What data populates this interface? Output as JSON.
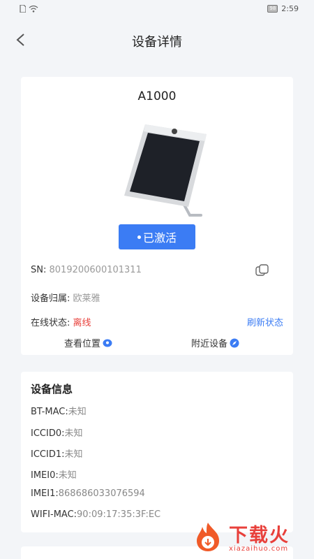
{
  "status_bar": {
    "time": "2:59",
    "battery": "98",
    "sim_icon": "sim-card-icon",
    "wifi_icon": "wifi-icon"
  },
  "nav": {
    "title": "设备详情",
    "back_icon": "chevron-left-icon"
  },
  "device": {
    "model": "A1000",
    "status_button": "已激活",
    "sn_label": "SN: ",
    "sn_value": "8019200600101311",
    "owner_label": "设备归属: ",
    "owner_value": "欧莱雅",
    "online_label": "在线状态: ",
    "online_value": "离线",
    "refresh_label": "刷新状态",
    "view_location": "查看位置",
    "nearby_devices": "附近设备"
  },
  "info": {
    "title": "设备信息",
    "rows": [
      {
        "label": "BT-MAC:",
        "value": "未知"
      },
      {
        "label": "ICCID0:",
        "value": "未知"
      },
      {
        "label": "ICCID1:",
        "value": "未知"
      },
      {
        "label": "IMEI0:",
        "value": "未知"
      },
      {
        "label": "IMEI1:",
        "value": "868686033076594"
      },
      {
        "label": "WIFI-MAC:",
        "value": "90:09:17:35:3F:EC"
      }
    ]
  },
  "watermark": {
    "text": "下载火",
    "sub": "xiazaihuo.com"
  },
  "colors": {
    "accent": "#3b7cf4",
    "offline": "#e8403b",
    "background": "#f3f5f8"
  }
}
